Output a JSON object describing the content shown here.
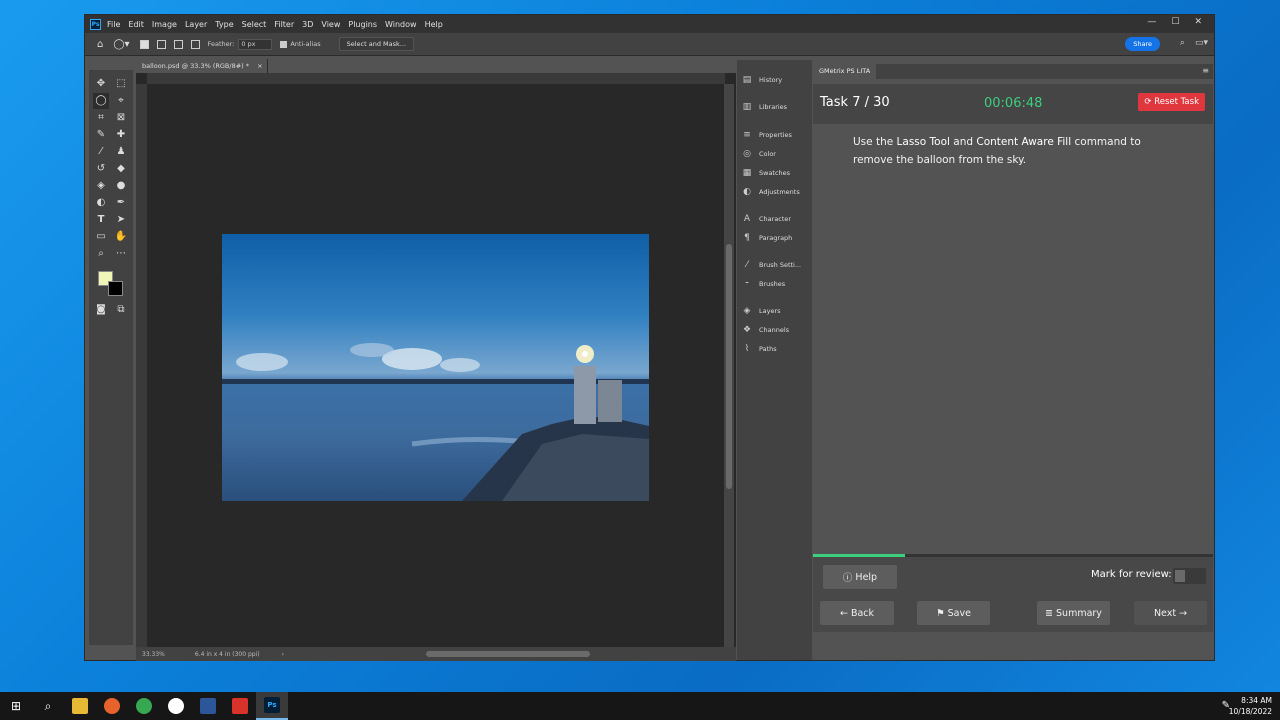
{
  "app": {
    "logo": "Ps",
    "menu": [
      "File",
      "Edit",
      "Image",
      "Layer",
      "Type",
      "Select",
      "Filter",
      "3D",
      "View",
      "Plugins",
      "Window",
      "Help"
    ],
    "window_controls": [
      "—",
      "☐",
      "✕"
    ]
  },
  "options_bar": {
    "feather_label": "Feather:",
    "feather_value": "0 px",
    "antialias_label": "Anti-alias",
    "select_mask_label": "Select and Mask...",
    "share_label": "Share"
  },
  "document": {
    "tab_title": "balloon.psd @ 33.3% (RGB/8#) *",
    "zoom": "33.33%",
    "doc_size": "6.4 in x 4 in (300 ppi)"
  },
  "panels": [
    "History",
    "Libraries",
    "Properties",
    "Color",
    "Swatches",
    "Adjustments",
    "Character",
    "Paragraph",
    "Brush Setti...",
    "Brushes",
    "Layers",
    "Channels",
    "Paths"
  ],
  "gmetrix": {
    "tab_label": "GMetrix PS LITA",
    "task_label": "Task 7 / 30",
    "timer": "00:06:48",
    "reset_label": "Reset Task",
    "instruction_parts": [
      "Use the ",
      "Lasso Tool",
      " and ",
      "Content Aware Fill",
      " command to remove the balloon from the sky."
    ],
    "progress_percent": 23,
    "help_label": "Help",
    "review_label": "Mark for review:",
    "back_label": "Back",
    "save_label": "Save",
    "summary_label": "Summary",
    "next_label": "Next"
  },
  "taskbar": {
    "time": "8:34 AM",
    "date": "10/18/2022"
  }
}
